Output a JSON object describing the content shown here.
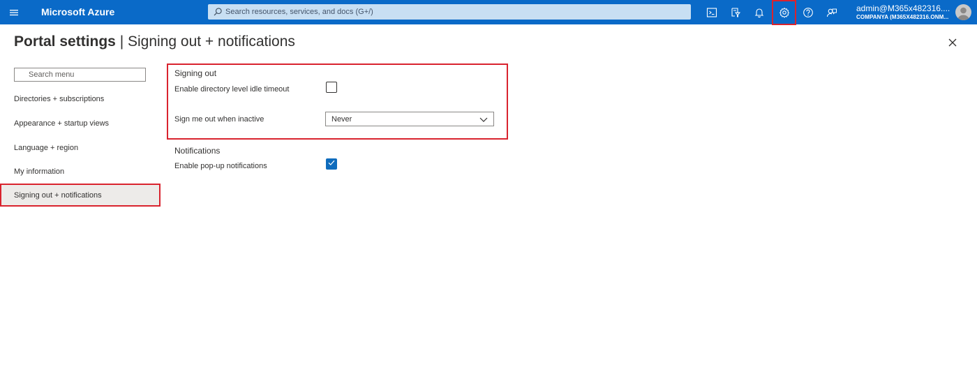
{
  "topbar": {
    "brand": "Microsoft Azure",
    "search_placeholder": "Search resources, services, and docs (G+/)",
    "icons": [
      "cloud-shell-icon",
      "directory-filter-icon",
      "notifications-icon",
      "settings-icon",
      "help-icon",
      "feedback-icon"
    ],
    "user_name": "admin@M365x482316....",
    "user_tenant": "COMPANYA (M365X482316.ONM..."
  },
  "page": {
    "title_bold": "Portal settings",
    "title_separator": " | ",
    "title_rest": "Signing out + notifications"
  },
  "menu": {
    "search_placeholder": "Search menu",
    "items": [
      {
        "label": "Directories + subscriptions",
        "active": false
      },
      {
        "label": "Appearance + startup views",
        "active": false
      },
      {
        "label": "Language + region",
        "active": false
      },
      {
        "label": "My information",
        "active": false
      },
      {
        "label": "Signing out + notifications",
        "active": true
      }
    ]
  },
  "signing_out": {
    "title": "Signing out",
    "idle_timeout_label": "Enable directory level idle timeout",
    "idle_timeout_checked": false,
    "inactive_label": "Sign me out when inactive",
    "inactive_value": "Never"
  },
  "notifications": {
    "title": "Notifications",
    "popup_label": "Enable pop-up notifications",
    "popup_checked": true
  },
  "colors": {
    "topbar": "#0a6ac8",
    "highlight": "#d9232e",
    "accent": "#0f6cbd"
  }
}
